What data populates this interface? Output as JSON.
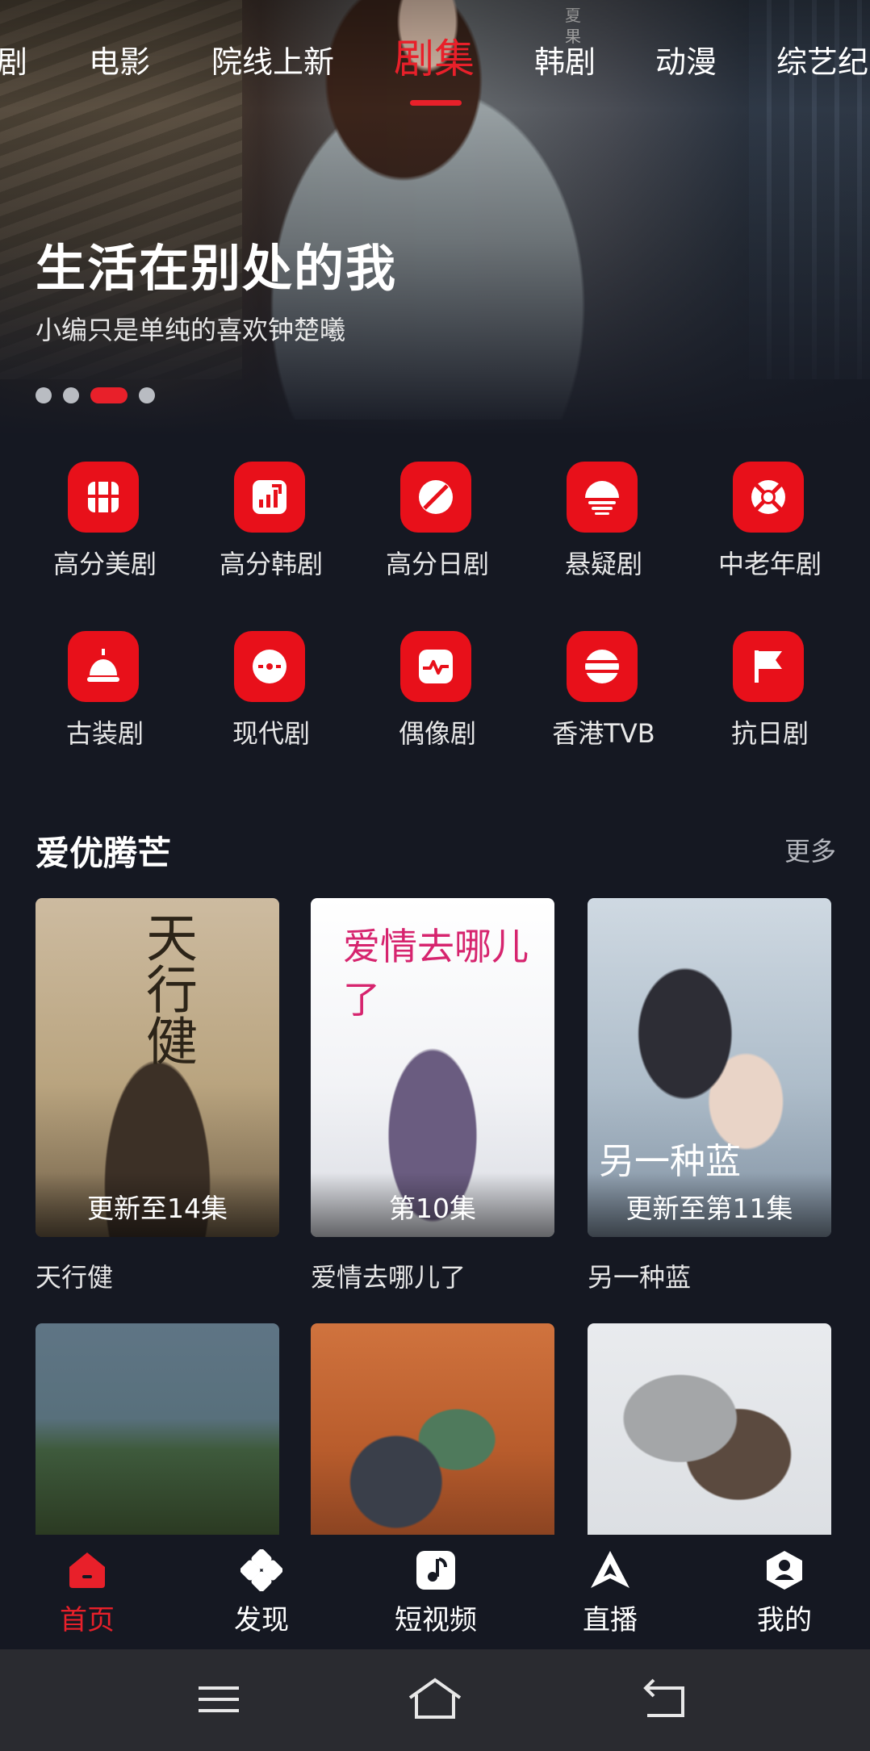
{
  "top_tabs": [
    "剧",
    "电影",
    "院线上新",
    "剧集",
    "韩剧",
    "动漫",
    "综艺纪"
  ],
  "active_tab": "剧集",
  "banner": {
    "title": "生活在别处的我",
    "subtitle": "小编只是单纯的喜欢钟楚曦",
    "poster_text": "夏 果",
    "slide_count": 4,
    "active_slide": 3
  },
  "categories": [
    {
      "label": "高分美剧",
      "icon": "grid-film-icon"
    },
    {
      "label": "高分韩剧",
      "icon": "chart-icon"
    },
    {
      "label": "高分日剧",
      "icon": "slash-circle-icon"
    },
    {
      "label": "悬疑剧",
      "icon": "stripes-icon"
    },
    {
      "label": "中老年剧",
      "icon": "lifebuoy-icon"
    },
    {
      "label": "古装剧",
      "icon": "bell-icon"
    },
    {
      "label": "现代剧",
      "icon": "disc-icon"
    },
    {
      "label": "偶像剧",
      "icon": "pulse-icon"
    },
    {
      "label": "香港TVB",
      "icon": "ball-icon"
    },
    {
      "label": "抗日剧",
      "icon": "flag-icon"
    }
  ],
  "section": {
    "title": "爱优腾芒",
    "more": "更多",
    "items": [
      {
        "name": "天行健",
        "badge": "更新至14集",
        "art": "天行健"
      },
      {
        "name": "爱情去哪儿了",
        "badge": "第10集",
        "art": "爱情去哪儿了"
      },
      {
        "name": "另一种蓝",
        "badge": "更新至第11集",
        "art": "另一种蓝"
      },
      {
        "name": "",
        "badge": "",
        "art": ""
      },
      {
        "name": "",
        "badge": "",
        "art": ""
      },
      {
        "name": "",
        "badge": "",
        "art": ""
      }
    ]
  },
  "bottom_nav": [
    {
      "label": "首页",
      "icon": "home-icon",
      "active": true
    },
    {
      "label": "发现",
      "icon": "discover-icon",
      "active": false
    },
    {
      "label": "短视频",
      "icon": "music-note-icon",
      "active": false
    },
    {
      "label": "直播",
      "icon": "live-icon",
      "active": false
    },
    {
      "label": "我的",
      "icon": "profile-icon",
      "active": false
    }
  ],
  "colors": {
    "accent": "#e8202a",
    "background": "#151822",
    "system_bar": "#2a2b30"
  }
}
